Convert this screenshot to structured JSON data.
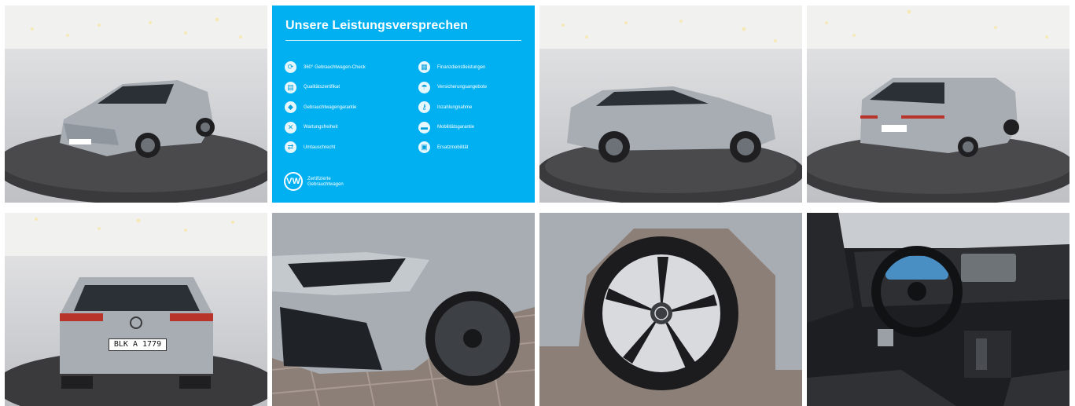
{
  "gallery": {
    "promise": {
      "title": "Unsere Leistungsversprechen",
      "left_items": [
        "360° Gebrauchtwagen-Check",
        "Qualitätszertifikat",
        "Gebrauchtwagengarantie",
        "Wartungsfreiheit",
        "Umtauschrecht"
      ],
      "right_items": [
        "Finanzdienstleistungen",
        "Versicherungsangebote",
        "Inzahlungnahme",
        "Mobilitätsgarantie",
        "Ersatzmobilität"
      ],
      "brand_label_line1": "Zertifizierte",
      "brand_label_line2": "Gebrauchtwagen",
      "brand_mark": "VW"
    },
    "plate_text": "BLK A 1779",
    "colors": {
      "promise_bg": "#00b0f0",
      "car_paint": "#a7adb3",
      "studio_wall": "#d6d7da",
      "turntable": "#3a3a3c"
    }
  }
}
